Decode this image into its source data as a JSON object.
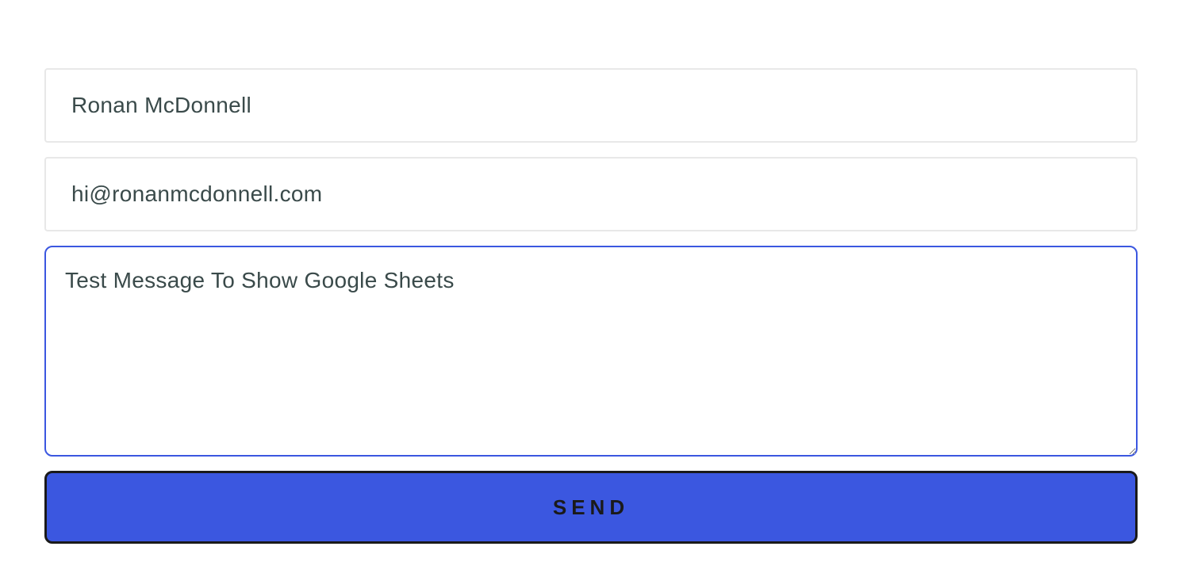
{
  "form": {
    "name": {
      "value": "Ronan McDonnell",
      "placeholder": ""
    },
    "email": {
      "value": "hi@ronanmcdonnell.com",
      "placeholder": ""
    },
    "message": {
      "value": "Test Message To Show Google Sheets",
      "placeholder": ""
    },
    "submit_label": "SEND"
  }
}
